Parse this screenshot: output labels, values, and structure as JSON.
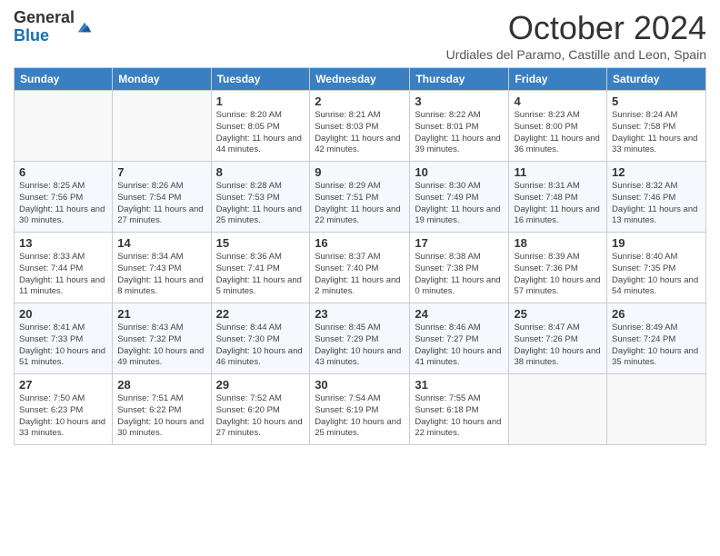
{
  "header": {
    "logo_general": "General",
    "logo_blue": "Blue",
    "month_title": "October 2024",
    "location": "Urdiales del Paramo, Castille and Leon, Spain"
  },
  "columns": [
    "Sunday",
    "Monday",
    "Tuesday",
    "Wednesday",
    "Thursday",
    "Friday",
    "Saturday"
  ],
  "weeks": [
    [
      {
        "day": "",
        "info": ""
      },
      {
        "day": "",
        "info": ""
      },
      {
        "day": "1",
        "info": "Sunrise: 8:20 AM\nSunset: 8:05 PM\nDaylight: 11 hours and 44 minutes."
      },
      {
        "day": "2",
        "info": "Sunrise: 8:21 AM\nSunset: 8:03 PM\nDaylight: 11 hours and 42 minutes."
      },
      {
        "day": "3",
        "info": "Sunrise: 8:22 AM\nSunset: 8:01 PM\nDaylight: 11 hours and 39 minutes."
      },
      {
        "day": "4",
        "info": "Sunrise: 8:23 AM\nSunset: 8:00 PM\nDaylight: 11 hours and 36 minutes."
      },
      {
        "day": "5",
        "info": "Sunrise: 8:24 AM\nSunset: 7:58 PM\nDaylight: 11 hours and 33 minutes."
      }
    ],
    [
      {
        "day": "6",
        "info": "Sunrise: 8:25 AM\nSunset: 7:56 PM\nDaylight: 11 hours and 30 minutes."
      },
      {
        "day": "7",
        "info": "Sunrise: 8:26 AM\nSunset: 7:54 PM\nDaylight: 11 hours and 27 minutes."
      },
      {
        "day": "8",
        "info": "Sunrise: 8:28 AM\nSunset: 7:53 PM\nDaylight: 11 hours and 25 minutes."
      },
      {
        "day": "9",
        "info": "Sunrise: 8:29 AM\nSunset: 7:51 PM\nDaylight: 11 hours and 22 minutes."
      },
      {
        "day": "10",
        "info": "Sunrise: 8:30 AM\nSunset: 7:49 PM\nDaylight: 11 hours and 19 minutes."
      },
      {
        "day": "11",
        "info": "Sunrise: 8:31 AM\nSunset: 7:48 PM\nDaylight: 11 hours and 16 minutes."
      },
      {
        "day": "12",
        "info": "Sunrise: 8:32 AM\nSunset: 7:46 PM\nDaylight: 11 hours and 13 minutes."
      }
    ],
    [
      {
        "day": "13",
        "info": "Sunrise: 8:33 AM\nSunset: 7:44 PM\nDaylight: 11 hours and 11 minutes."
      },
      {
        "day": "14",
        "info": "Sunrise: 8:34 AM\nSunset: 7:43 PM\nDaylight: 11 hours and 8 minutes."
      },
      {
        "day": "15",
        "info": "Sunrise: 8:36 AM\nSunset: 7:41 PM\nDaylight: 11 hours and 5 minutes."
      },
      {
        "day": "16",
        "info": "Sunrise: 8:37 AM\nSunset: 7:40 PM\nDaylight: 11 hours and 2 minutes."
      },
      {
        "day": "17",
        "info": "Sunrise: 8:38 AM\nSunset: 7:38 PM\nDaylight: 11 hours and 0 minutes."
      },
      {
        "day": "18",
        "info": "Sunrise: 8:39 AM\nSunset: 7:36 PM\nDaylight: 10 hours and 57 minutes."
      },
      {
        "day": "19",
        "info": "Sunrise: 8:40 AM\nSunset: 7:35 PM\nDaylight: 10 hours and 54 minutes."
      }
    ],
    [
      {
        "day": "20",
        "info": "Sunrise: 8:41 AM\nSunset: 7:33 PM\nDaylight: 10 hours and 51 minutes."
      },
      {
        "day": "21",
        "info": "Sunrise: 8:43 AM\nSunset: 7:32 PM\nDaylight: 10 hours and 49 minutes."
      },
      {
        "day": "22",
        "info": "Sunrise: 8:44 AM\nSunset: 7:30 PM\nDaylight: 10 hours and 46 minutes."
      },
      {
        "day": "23",
        "info": "Sunrise: 8:45 AM\nSunset: 7:29 PM\nDaylight: 10 hours and 43 minutes."
      },
      {
        "day": "24",
        "info": "Sunrise: 8:46 AM\nSunset: 7:27 PM\nDaylight: 10 hours and 41 minutes."
      },
      {
        "day": "25",
        "info": "Sunrise: 8:47 AM\nSunset: 7:26 PM\nDaylight: 10 hours and 38 minutes."
      },
      {
        "day": "26",
        "info": "Sunrise: 8:49 AM\nSunset: 7:24 PM\nDaylight: 10 hours and 35 minutes."
      }
    ],
    [
      {
        "day": "27",
        "info": "Sunrise: 7:50 AM\nSunset: 6:23 PM\nDaylight: 10 hours and 33 minutes."
      },
      {
        "day": "28",
        "info": "Sunrise: 7:51 AM\nSunset: 6:22 PM\nDaylight: 10 hours and 30 minutes."
      },
      {
        "day": "29",
        "info": "Sunrise: 7:52 AM\nSunset: 6:20 PM\nDaylight: 10 hours and 27 minutes."
      },
      {
        "day": "30",
        "info": "Sunrise: 7:54 AM\nSunset: 6:19 PM\nDaylight: 10 hours and 25 minutes."
      },
      {
        "day": "31",
        "info": "Sunrise: 7:55 AM\nSunset: 6:18 PM\nDaylight: 10 hours and 22 minutes."
      },
      {
        "day": "",
        "info": ""
      },
      {
        "day": "",
        "info": ""
      }
    ]
  ]
}
